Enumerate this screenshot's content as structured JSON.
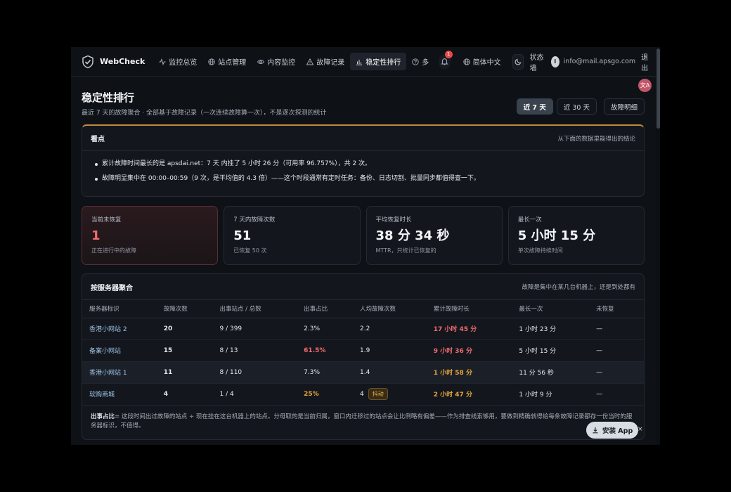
{
  "nav": {
    "brand": "WebCheck",
    "items": [
      {
        "label": "监控总览",
        "icon": "activity-icon"
      },
      {
        "label": "站点管理",
        "icon": "globe-icon"
      },
      {
        "label": "内容监控",
        "icon": "eye-icon"
      },
      {
        "label": "故障记录",
        "icon": "warning-icon"
      },
      {
        "label": "稳定性排行",
        "icon": "bar-chart-icon"
      }
    ],
    "more_label": "多",
    "notification_count": "1",
    "language": "简体中文",
    "status_wall": "状态墙",
    "avatar_letter": "I",
    "email": "info@mail.apsgo.com",
    "logout": "退出"
  },
  "page": {
    "title": "稳定性排行",
    "subtitle": "最近 7 天的故障聚合 · 全部基于故障记录（一次连续故障算一次），不是逐次探测的统计",
    "ranges": [
      "近 7 天",
      "近 30 天"
    ],
    "detail_button": "故障明细"
  },
  "insight": {
    "title": "看点",
    "note": "从下面的数据里能得出的结论",
    "points": [
      "累计故障时间最长的是 apsdai.net：7 天 内挂了 5 小时 26 分（可用率 96.757%），共 2 次。",
      "故障明显集中在 00:00–00:59（9 次，是平均值的 4.3 倍）——这个时段通常有定时任务：备份、日志切割、批量同步都值得查一下。"
    ]
  },
  "stats": [
    {
      "label": "当前未恢复",
      "value": "1",
      "sub": "正在进行中的故障"
    },
    {
      "label": "7 天内故障次数",
      "value": "51",
      "sub": "已恢复 50 次"
    },
    {
      "label": "平均恢复时长",
      "value": "38 分 34 秒",
      "sub": "MTTR，只统计已恢复的"
    },
    {
      "label": "最长一次",
      "value": "5 小时 15 分",
      "sub": "单次故障持续时间"
    }
  ],
  "servers": {
    "title": "按服务器聚合",
    "note": "故障是集中在某几台机器上，还是到处都有",
    "columns": [
      "服务器标识",
      "故障次数",
      "出事站点 / 总数",
      "出事占比",
      "人均故障次数",
      "累计故障时长",
      "最长一次",
      "未恢复"
    ],
    "rows": [
      {
        "name": "香港小网站 2",
        "count": "20",
        "sites": "9 / 399",
        "ratio": "2.3%",
        "avg": "2.2",
        "total": "17 小时 45 分",
        "longest": "1 小时 23 分",
        "open": "—"
      },
      {
        "name": "备案小网站",
        "count": "15",
        "sites": "8 / 13",
        "ratio": "61.5%",
        "avg": "1.9",
        "total": "9 小时 36 分",
        "longest": "5 小时 15 分",
        "open": "—"
      },
      {
        "name": "香港小网站 1",
        "count": "11",
        "sites": "8 / 110",
        "ratio": "7.3%",
        "avg": "1.4",
        "total": "1 小时 58 分",
        "longest": "11 分 56 秒",
        "open": "—"
      },
      {
        "name": "软购商城",
        "count": "4",
        "sites": "1 / 4",
        "ratio": "25%",
        "avg": "4",
        "tag": "抖动",
        "total": "2 小时 47 分",
        "longest": "1 小时 9 分",
        "open": "—"
      }
    ],
    "footnote_label": "出事占比",
    "footnote": "= 这段时间出过故障的站点 ÷ 现在挂在这台机器上的站点。分母取的是当前归属，窗口内迁移过的站点会让比例略有偏差——作为排查线索够用，要做到精确就得给每条故障记录都存一份当时的服务器标识，不值得。"
  },
  "install": {
    "label": "安装 App",
    "close": "×"
  },
  "colors": {
    "accent_red": "#f06a6f",
    "accent_orange": "#e5a33a",
    "link_blue": "#9cc4e4"
  }
}
